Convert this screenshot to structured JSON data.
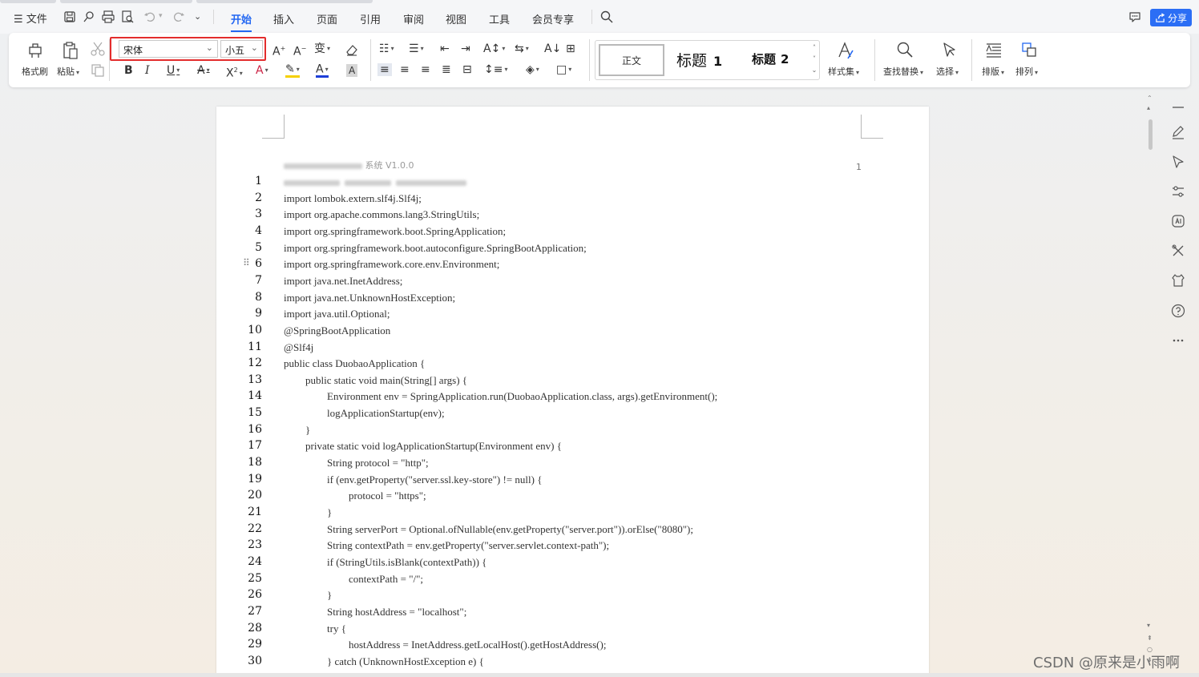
{
  "menubar": {
    "file_label": "文件",
    "tabs": [
      "开始",
      "插入",
      "页面",
      "引用",
      "审阅",
      "视图",
      "工具",
      "会员专享"
    ],
    "active_tab": "开始",
    "share_label": "分享"
  },
  "ribbon": {
    "format_painter_label": "格式刷",
    "paste_label": "粘贴",
    "font_name": "宋体",
    "font_size": "小五",
    "styles": {
      "normal_label": "正文",
      "heading1_label": "标题",
      "heading1_num": "1",
      "heading2_label": "标题",
      "heading2_num": "2"
    },
    "style_set_label": "样式集",
    "find_replace_label": "查找替换",
    "select_label": "选择",
    "layout_label": "排版",
    "arrange_label": "排列"
  },
  "document": {
    "header_text": "系统 V1.0.0",
    "page_number": "1",
    "lines": [
      {
        "n": "1",
        "text": "",
        "indent": 0,
        "blurred": true
      },
      {
        "n": "2",
        "text": "import lombok.extern.slf4j.Slf4j;",
        "indent": 0
      },
      {
        "n": "3",
        "text": "import org.apache.commons.lang3.StringUtils;",
        "indent": 0
      },
      {
        "n": "4",
        "text": "import org.springframework.boot.SpringApplication;",
        "indent": 0
      },
      {
        "n": "5",
        "text": "import org.springframework.boot.autoconfigure.SpringBootApplication;",
        "indent": 0
      },
      {
        "n": "6",
        "text": "import org.springframework.core.env.Environment;",
        "indent": 0
      },
      {
        "n": "7",
        "text": "import java.net.InetAddress;",
        "indent": 0
      },
      {
        "n": "8",
        "text": "import java.net.UnknownHostException;",
        "indent": 0
      },
      {
        "n": "9",
        "text": "import java.util.Optional;",
        "indent": 0
      },
      {
        "n": "10",
        "text": "@SpringBootApplication",
        "indent": 0
      },
      {
        "n": "11",
        "text": "@Slf4j",
        "indent": 0
      },
      {
        "n": "12",
        "text": "public class DuobaoApplication {",
        "indent": 0
      },
      {
        "n": "13",
        "text": "public static void main(String[] args) {",
        "indent": 1
      },
      {
        "n": "14",
        "text": "Environment env = SpringApplication.run(DuobaoApplication.class, args).getEnvironment();",
        "indent": 2
      },
      {
        "n": "15",
        "text": "logApplicationStartup(env);",
        "indent": 2
      },
      {
        "n": "16",
        "text": "}",
        "indent": 1
      },
      {
        "n": "17",
        "text": "private static void logApplicationStartup(Environment env) {",
        "indent": 1
      },
      {
        "n": "18",
        "text": "String protocol = \"http\";",
        "indent": 2
      },
      {
        "n": "19",
        "text": "if (env.getProperty(\"server.ssl.key-store\") != null) {",
        "indent": 2
      },
      {
        "n": "20",
        "text": "protocol = \"https\";",
        "indent": 3
      },
      {
        "n": "21",
        "text": "}",
        "indent": 2
      },
      {
        "n": "22",
        "text": "String serverPort = Optional.ofNullable(env.getProperty(\"server.port\")).orElse(\"8080\");",
        "indent": 2
      },
      {
        "n": "23",
        "text": "String contextPath = env.getProperty(\"server.servlet.context-path\");",
        "indent": 2
      },
      {
        "n": "24",
        "text": "if (StringUtils.isBlank(contextPath)) {",
        "indent": 2
      },
      {
        "n": "25",
        "text": "contextPath = \"/\";",
        "indent": 3
      },
      {
        "n": "26",
        "text": "}",
        "indent": 2
      },
      {
        "n": "27",
        "text": "String hostAddress = \"localhost\";",
        "indent": 2
      },
      {
        "n": "28",
        "text": "try {",
        "indent": 2
      },
      {
        "n": "29",
        "text": "hostAddress = InetAddress.getLocalHost().getHostAddress();",
        "indent": 3
      },
      {
        "n": "30",
        "text": "} catch (UnknownHostException e) {",
        "indent": 2
      }
    ]
  },
  "watermark": "CSDN @原来是小雨啊",
  "colors": {
    "accent": "#2468f2",
    "share_button": "#2b6ef5",
    "highlight_outline": "#e32d2d"
  }
}
